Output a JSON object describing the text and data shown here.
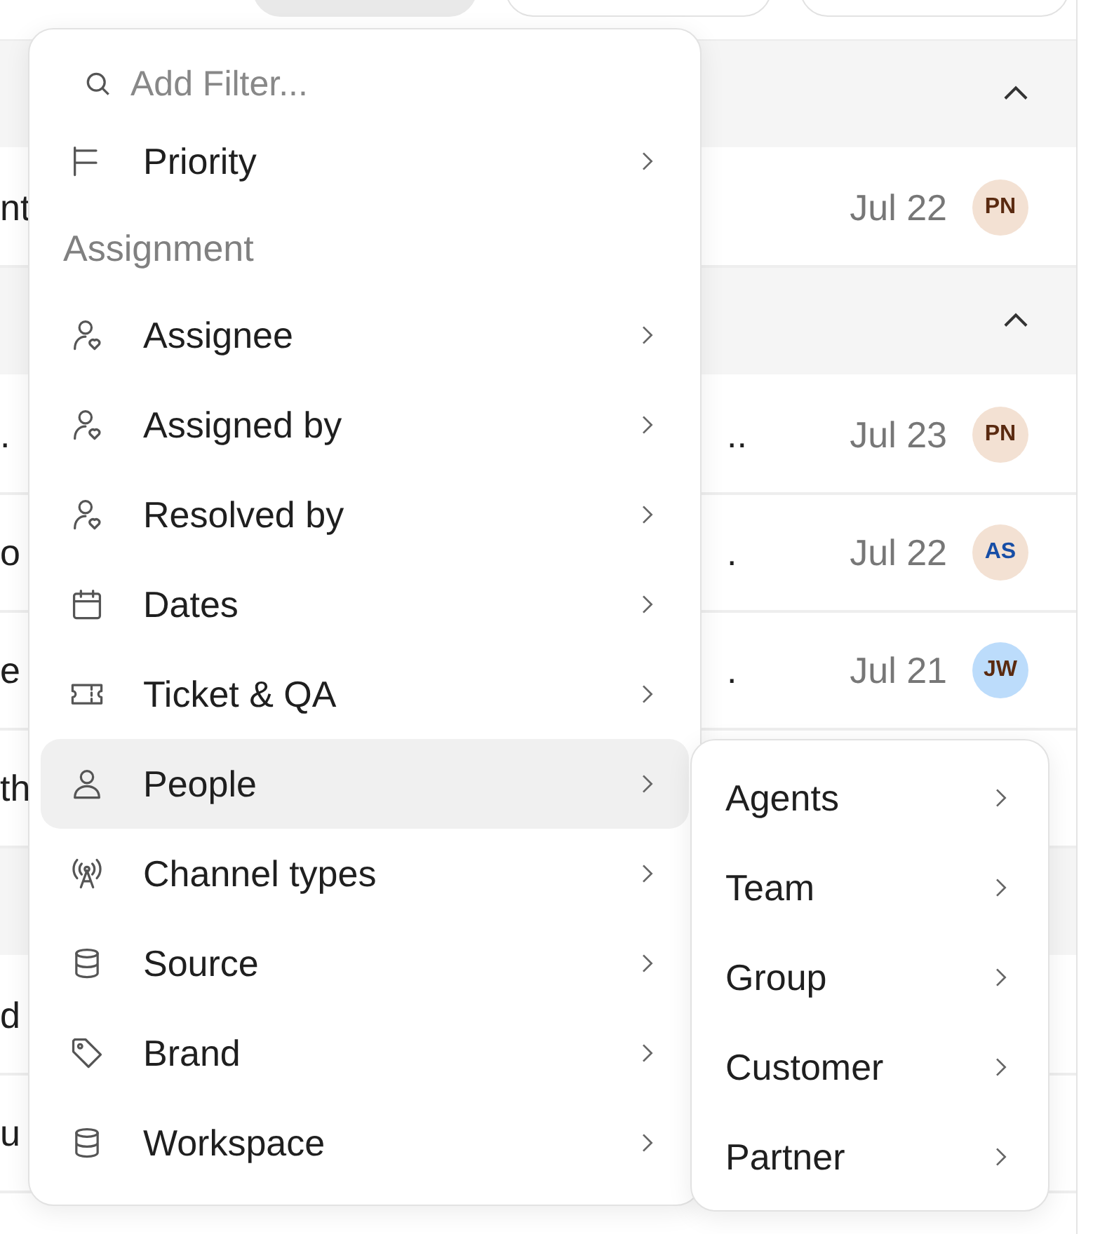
{
  "toolbar": {
    "pills": [
      {
        "selected": true
      },
      {
        "selected": false
      },
      {
        "selected": false
      }
    ]
  },
  "list": [
    {
      "kind": "header",
      "expanded": true
    },
    {
      "kind": "row",
      "text": "nt",
      "date": "Jul 22",
      "avatar": {
        "initials": "PN",
        "color": "#f3e1d3"
      }
    },
    {
      "kind": "header",
      "expanded": true
    },
    {
      "kind": "row",
      "text": ".",
      "tail": "..",
      "date": "Jul 23",
      "avatar": {
        "initials": "PN",
        "color": "#f3e1d3"
      }
    },
    {
      "kind": "row",
      "text": "o",
      "tail": ".",
      "date": "Jul 22",
      "avatar": {
        "initials": "AS",
        "color": "#f3e1d3"
      }
    },
    {
      "kind": "row",
      "text": "e",
      "tail": ".",
      "date": "Jul 21",
      "avatar": {
        "initials": "JW",
        "color": "#bcdcfb"
      }
    },
    {
      "kind": "row",
      "text": "th"
    },
    {
      "kind": "header"
    },
    {
      "kind": "row",
      "text": "d"
    },
    {
      "kind": "row",
      "text": "u"
    }
  ],
  "filter_menu": {
    "search": {
      "placeholder": "Add Filter..."
    },
    "entries": [
      {
        "kind": "item",
        "label": "Priority",
        "selected": false
      },
      {
        "kind": "heading",
        "label": "Assignment"
      },
      {
        "kind": "item",
        "label": "Assignee",
        "selected": false
      },
      {
        "kind": "item",
        "label": "Assigned by",
        "selected": false
      },
      {
        "kind": "item",
        "label": "Resolved by",
        "selected": false
      },
      {
        "kind": "item",
        "label": "Dates",
        "selected": false
      },
      {
        "kind": "item",
        "label": "Ticket & QA",
        "selected": false
      },
      {
        "kind": "item",
        "label": "People",
        "selected": true
      },
      {
        "kind": "item",
        "label": "Channel types",
        "selected": false
      },
      {
        "kind": "item",
        "label": "Source",
        "selected": false
      },
      {
        "kind": "item",
        "label": "Brand",
        "selected": false
      },
      {
        "kind": "item",
        "label": "Workspace",
        "selected": false
      }
    ]
  },
  "submenu": {
    "items": [
      {
        "label": "Agents"
      },
      {
        "label": "Team"
      },
      {
        "label": "Group"
      },
      {
        "label": "Customer"
      },
      {
        "label": "Partner"
      }
    ]
  }
}
